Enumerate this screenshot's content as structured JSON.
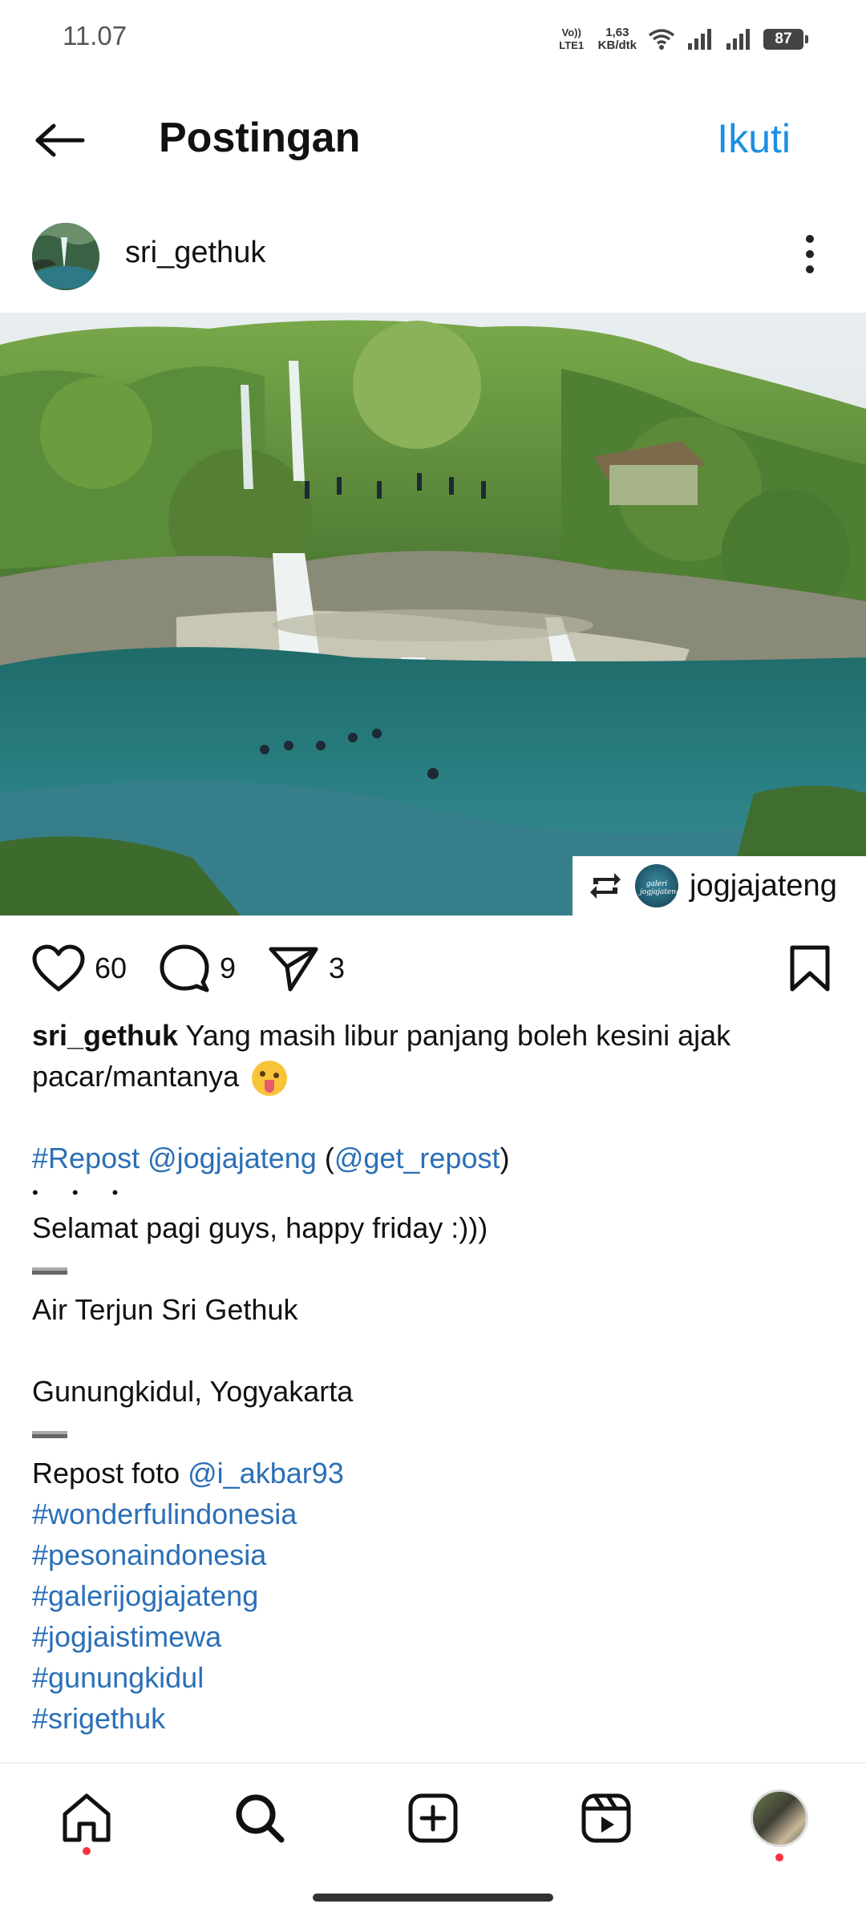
{
  "status_bar": {
    "time": "11.07",
    "net_label_1": "Vo)) LTE1",
    "net_speed_1": "1,63",
    "net_speed_2": "KB/dtk",
    "battery": "87"
  },
  "top_bar": {
    "title": "Postingan",
    "follow_label": "Ikuti",
    "back_icon": "arrow-left-icon"
  },
  "post": {
    "username": "sri_gethuk",
    "repost_from": "jogjajateng",
    "repost_avatar_text": "galeri jogjajateng",
    "likes": "60",
    "comments": "9",
    "shares": "3"
  },
  "caption": {
    "username": "sri_gethuk",
    "line1": " Yang masih libur panjang boleh kesini ajak",
    "line2": "pacar/mantanya ",
    "repost_tag": "#Repost",
    "repost_mention": "@jogjajateng",
    "paren_open": " (",
    "get_repost": "@get_repost",
    "paren_close": ")",
    "dots": "• • •",
    "greeting": "Selamat pagi guys, happy friday :)))",
    "place": "Air Terjun Sri Gethuk",
    "location": "Gunungkidul, Yogyakarta",
    "photo_credit_label": "Repost foto ",
    "photo_credit_user": "@i_akbar93",
    "hashtags": [
      "#wonderfulindonesia",
      "#pesonaindonesia",
      "#galerijogjajateng",
      "#jogjaistimewa",
      "#gunungkidul",
      "#srigethuk"
    ]
  },
  "bottom_nav": {
    "items": [
      "home-icon",
      "search-icon",
      "create-icon",
      "reels-icon",
      "profile-avatar"
    ]
  },
  "colors": {
    "accent": "#1a8fe3",
    "link": "#2b6fb6",
    "notification_dot": "#ff3040"
  }
}
